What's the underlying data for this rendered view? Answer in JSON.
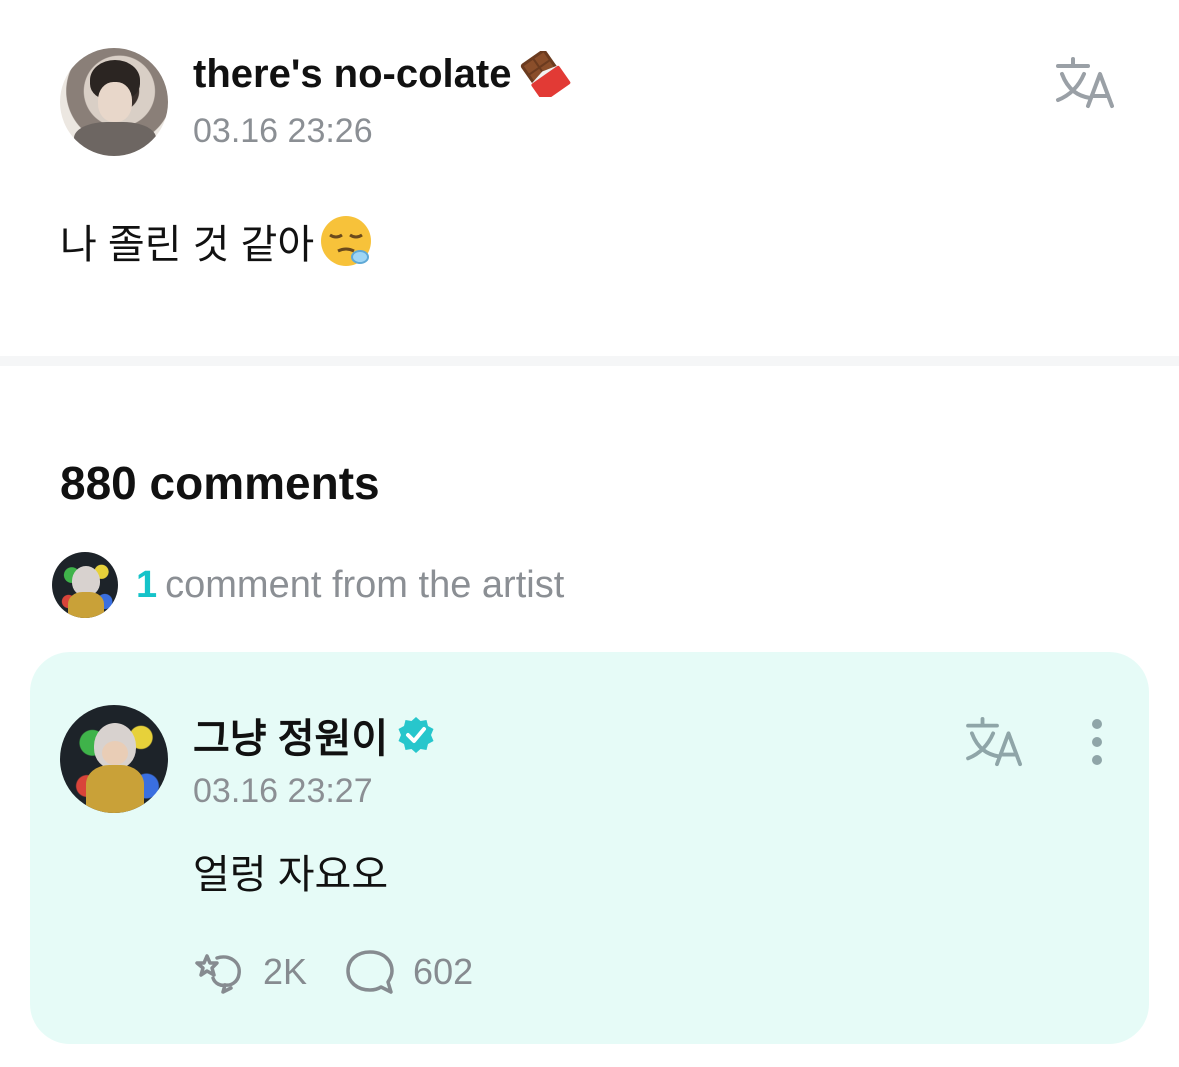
{
  "post": {
    "author": "there's no-colate",
    "author_emoji": "chocolate-bar-icon",
    "timestamp": "03.16 23:26",
    "body": "나 졸린 것 같아",
    "body_emoji": "sleepy-face-icon"
  },
  "comments": {
    "count_label": "880 comments",
    "artist_summary": {
      "count": "1",
      "label": "comment from the artist"
    },
    "items": [
      {
        "author": "그냥 정원이",
        "verified": true,
        "timestamp": "03.16 23:27",
        "body": "얼렁 자요오",
        "likes": "2K",
        "replies": "602"
      }
    ]
  },
  "colors": {
    "accent": "#15c3c9",
    "card_background": "#e6fbf7",
    "muted_text": "#8b8f94"
  }
}
